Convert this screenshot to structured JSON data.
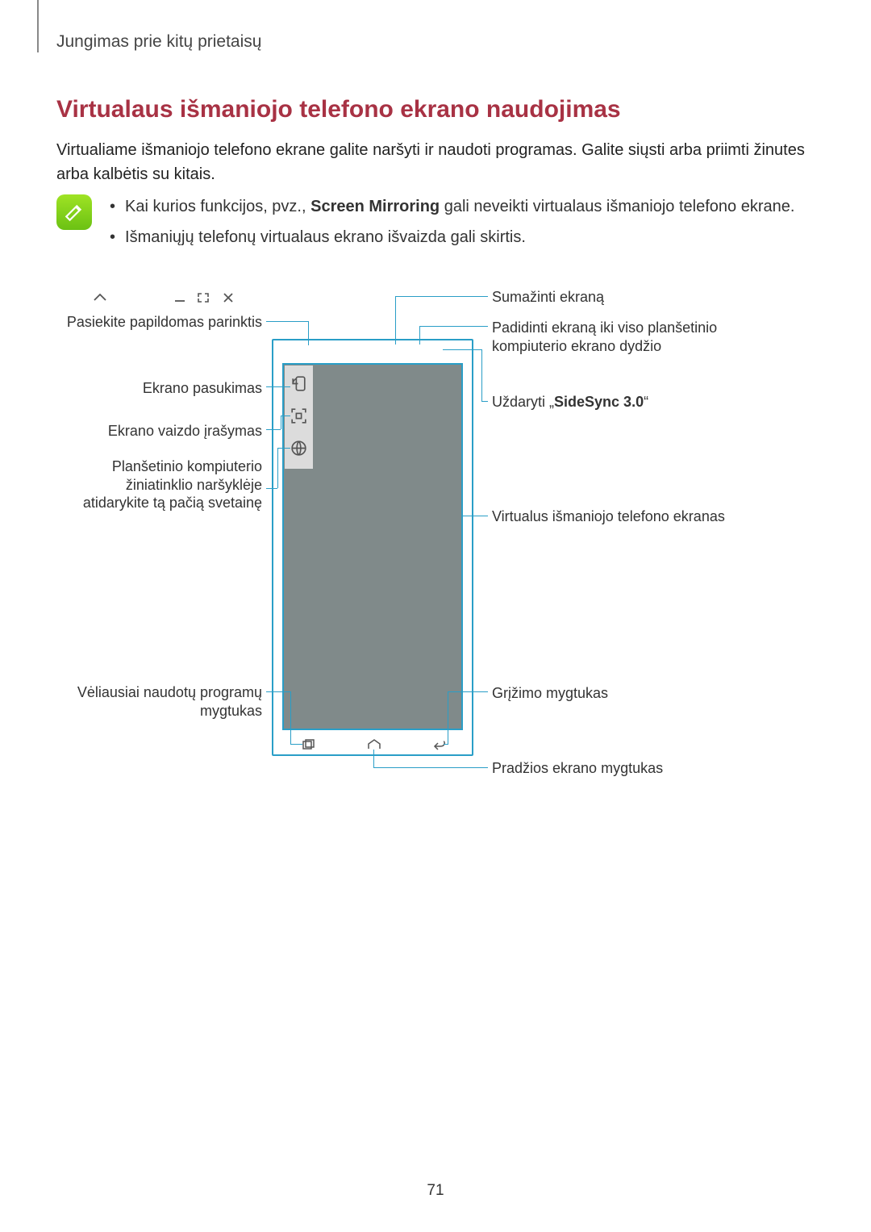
{
  "page_label": "Jungimas prie kitų prietaisų",
  "title": "Virtualaus išmaniojo telefono ekrano naudojimas",
  "intro": "Virtualiame išmaniojo telefono ekrane galite naršyti ir naudoti programas. Galite siųsti arba priimti žinutes arba kalbėtis su kitais.",
  "notes": {
    "b1_pre": "Kai kurios funkcijos, pvz., ",
    "b1_bold": "Screen Mirroring",
    "b1_post": " gali neveikti virtualaus išmaniojo telefono ekrane.",
    "b2": "Išmaniųjų telefonų virtualaus ekrano išvaizda gali skirtis."
  },
  "callouts": {
    "l_more_options": "Pasiekite papildomas parinktis",
    "l_rotate": "Ekrano pasukimas",
    "l_capture": "Ekrano vaizdo įrašymas",
    "l_open_web": "Planšetinio kompiuterio žiniatinklio naršyklėje atidarykite tą pačią svetainę",
    "l_recent": "Vėliausiai naudotų programų mygtukas",
    "r_minimize": "Sumažinti ekraną",
    "r_maximize": "Padidinti ekraną iki viso planšetinio kompiuterio ekrano dydžio",
    "r_close_pre": "Uždaryti „",
    "r_close_bold": "SideSync 3.0",
    "r_close_post": "“",
    "r_virtual_screen": "Virtualus išmaniojo telefono ekranas",
    "r_back": "Grįžimo mygtukas",
    "r_home": "Pradžios ekrano mygtukas"
  },
  "page_number": "71"
}
